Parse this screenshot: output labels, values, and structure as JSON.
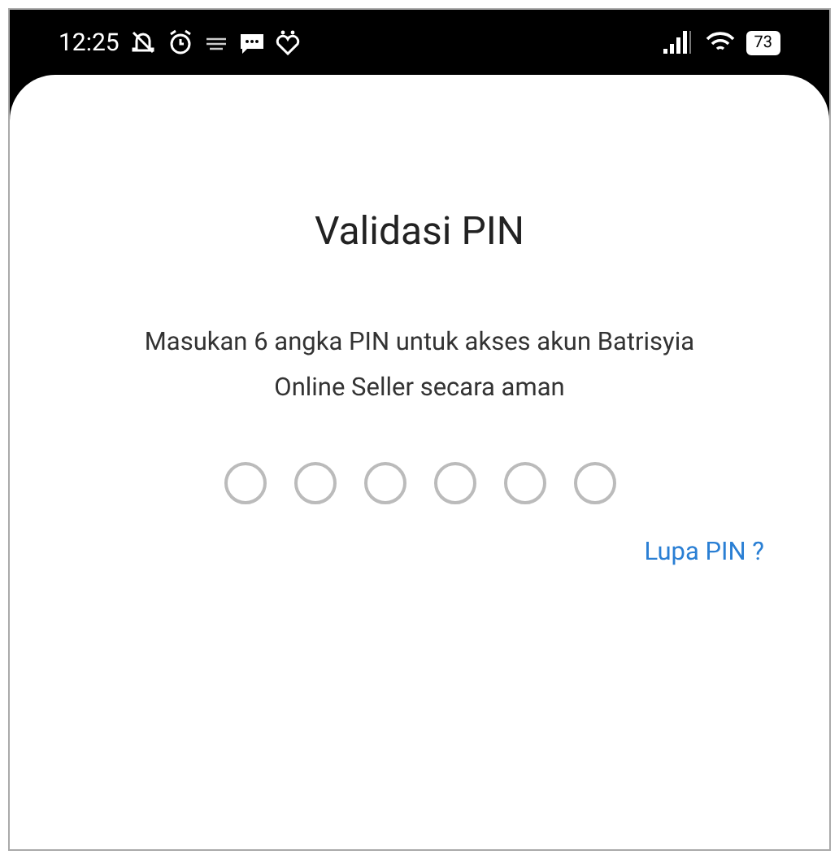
{
  "status_bar": {
    "time": "12:25",
    "battery": "73"
  },
  "title": "Validasi PIN",
  "instruction": "Masukan 6 angka PIN untuk akses akun Batrisyia Online Seller secara aman",
  "pin_digits": [
    {
      "filled": false
    },
    {
      "filled": false
    },
    {
      "filled": false
    },
    {
      "filled": false
    },
    {
      "filled": false
    },
    {
      "filled": false
    }
  ],
  "forgot_link": "Lupa PIN ?"
}
